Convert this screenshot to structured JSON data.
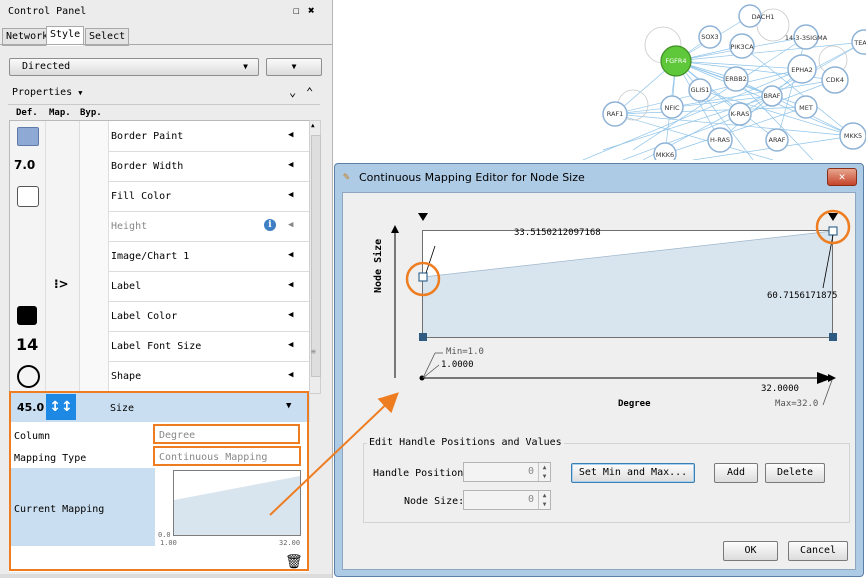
{
  "control_panel": {
    "title": "Control Panel",
    "tabs": [
      "Network",
      "Style",
      "Select"
    ],
    "style_dropdown": "Directed",
    "properties_label": "Properties",
    "col_headers": [
      "Def.",
      "Map.",
      "Byp."
    ],
    "rows": [
      {
        "label": "Border Paint",
        "default": ""
      },
      {
        "label": "Border Width",
        "default": "7.0"
      },
      {
        "label": "Fill Color",
        "default": ""
      },
      {
        "label": "Height",
        "default": ""
      },
      {
        "label": "Image/Chart 1",
        "default": ""
      },
      {
        "label": "Label",
        "default": ""
      },
      {
        "label": "Label Color",
        "default": ""
      },
      {
        "label": "Label Font Size",
        "default": "14"
      },
      {
        "label": "Shape",
        "default": ""
      }
    ],
    "size_row": {
      "label": "Size",
      "default": "45.0"
    },
    "column_label": "Column",
    "column_value": "Degree",
    "mapping_type_label": "Mapping Type",
    "mapping_type_value": "Continuous Mapping",
    "current_mapping_label": "Current Mapping",
    "mini_axis": {
      "y_top": "",
      "y_bottom": "0.0",
      "x_left": "1.00",
      "x_right": "32.00"
    }
  },
  "network_nodes": [
    "DACH1",
    "SOX3",
    "PIK3CA",
    "14-3-3SIGMA",
    "TEAD",
    "FGFR4",
    "ERBB2",
    "EPHA2",
    "CDK4",
    "GLIS1",
    "BRAF",
    "NFIC",
    "MET",
    "RAF1",
    "K-RAS",
    "MKK5",
    "H-RAS",
    "ARAF",
    "MKK6"
  ],
  "dialog": {
    "title": "Continuous Mapping Editor for Node Size",
    "y_axis_label": "Node Size",
    "x_axis_label": "Degree",
    "top_handle_value": "33.5150212097168",
    "right_handle_value": "60.7156171875",
    "min_label": "Min=1.0",
    "min_value": "1.0000",
    "max_value": "32.0000",
    "max_label": "Max=32.0",
    "group_title": "Edit Handle Positions and Values",
    "handle_position_label": "Handle Position:",
    "handle_position_value": "0",
    "node_size_label": "Node Size:",
    "node_size_value": "0",
    "set_min_max_label": "Set Min and Max...",
    "add_label": "Add",
    "delete_label": "Delete",
    "ok_label": "OK",
    "cancel_label": "Cancel"
  },
  "colors": {
    "accent_orange": "#ee7d22",
    "node_green": "#5fc83a",
    "selected_blue": "#c9def0",
    "mapping_fill": "#d9e5ee"
  }
}
